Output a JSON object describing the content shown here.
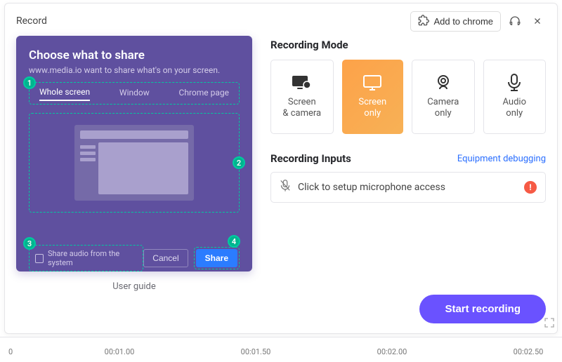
{
  "header": {
    "title": "Record",
    "add_to_chrome": "Add to chrome"
  },
  "guide": {
    "title": "Choose what to share",
    "subtitle": "www.media.io want to share what's on your screen.",
    "tabs": {
      "whole": "Whole screen",
      "window": "Window",
      "chrome": "Chrome page"
    },
    "share_audio": "Share audio from the system",
    "cancel": "Cancel",
    "share": "Share",
    "steps": {
      "s1": "1",
      "s2": "2",
      "s3": "3",
      "s4": "4"
    },
    "user_guide": "User guide"
  },
  "recording_mode": {
    "title": "Recording Mode",
    "modes": {
      "screen_camera": "Screen\n& camera",
      "screen_only": "Screen\nonly",
      "camera_only": "Camera\nonly",
      "audio_only": "Audio\nonly"
    }
  },
  "recording_inputs": {
    "title": "Recording Inputs",
    "debug_link": "Equipment debugging",
    "mic_prompt": "Click to setup microphone access"
  },
  "start_recording": "Start recording",
  "timeline": {
    "t0": "0",
    "t1": "00:01.00",
    "t2": "00:01.50",
    "t3": "00:02.00",
    "t4": "00:02.50"
  }
}
